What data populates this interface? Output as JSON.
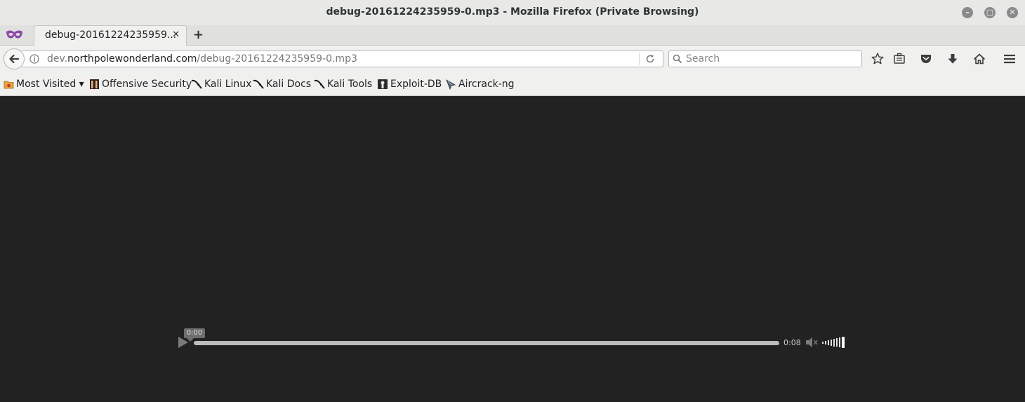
{
  "window": {
    "title": "debug-20161224235959-0.mp3 - Mozilla Firefox (Private Browsing)",
    "buttons": {
      "minimize": "–",
      "maximize": "▢",
      "close": "✕"
    }
  },
  "tabs": [
    {
      "label": "debug-20161224235959...",
      "close": "✕",
      "active": true
    }
  ],
  "new_tab_label": "+",
  "navbar": {
    "url_prefix": "dev.",
    "url_host": "northpolewonderland.com",
    "url_path": "/debug-20161224235959-0.mp3",
    "search_placeholder": "Search",
    "toolbar_icons": [
      "bookmark-star-icon",
      "reading-list-icon",
      "pocket-icon",
      "download-icon",
      "home-icon",
      "menu-icon"
    ]
  },
  "bookmarks": [
    {
      "label": "Most Visited ▾",
      "icon": "folder-icon"
    },
    {
      "label": "Offensive Security",
      "icon": "offsec-icon"
    },
    {
      "label": "Kali Linux",
      "icon": "kali-icon"
    },
    {
      "label": "Kali Docs",
      "icon": "kali-icon"
    },
    {
      "label": "Kali Tools",
      "icon": "kali-icon"
    },
    {
      "label": "Exploit-DB",
      "icon": "exploitdb-icon"
    },
    {
      "label": "Aircrack-ng",
      "icon": "aircrack-icon"
    }
  ],
  "player": {
    "current_time": "0:00",
    "duration": "0:08",
    "progress": 0,
    "volume_level": 1
  },
  "colors": {
    "content_background": "#222222",
    "chrome_background": "#f0f0ef",
    "private_mask": "#8c4aa8"
  }
}
